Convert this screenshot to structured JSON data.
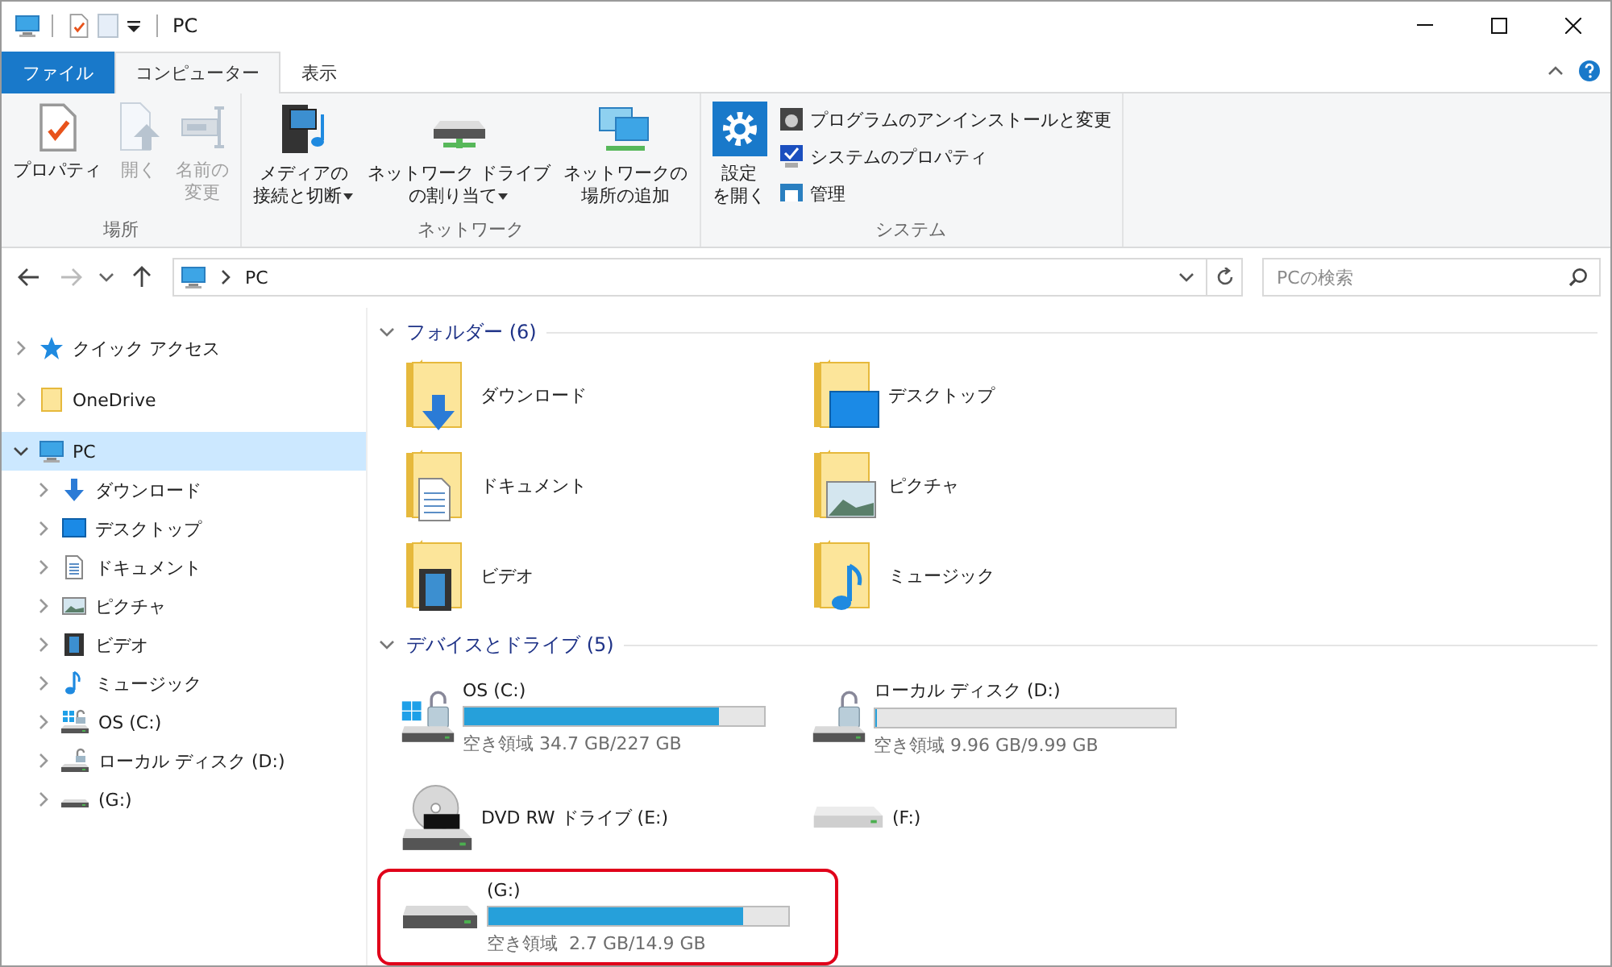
{
  "title_bar": {
    "title": "PC"
  },
  "ribbon_tabs": [
    {
      "label": "ファイル",
      "kind": "file",
      "selected": false
    },
    {
      "label": "コンピューター",
      "kind": "tab",
      "selected": true
    },
    {
      "label": "表示",
      "kind": "tab",
      "selected": false
    }
  ],
  "ribbon_groups": [
    {
      "label": "場所",
      "buttons": [
        {
          "lines": [
            "プロパティ"
          ],
          "kind": "properties",
          "disabled": false,
          "dropdown": false
        },
        {
          "lines": [
            "開く"
          ],
          "kind": "open",
          "disabled": true,
          "dropdown": false
        },
        {
          "lines": [
            "名前の",
            "変更"
          ],
          "kind": "rename",
          "disabled": true,
          "dropdown": false
        }
      ]
    },
    {
      "label": "ネットワーク",
      "buttons": [
        {
          "lines": [
            "メディアの",
            "接続と切断"
          ],
          "kind": "media",
          "disabled": false,
          "dropdown": true
        },
        {
          "lines": [
            "ネットワーク ドライブ",
            "の割り当て"
          ],
          "kind": "netdrive",
          "disabled": false,
          "dropdown": true
        },
        {
          "lines": [
            "ネットワークの",
            "場所の追加"
          ],
          "kind": "netplace",
          "disabled": false,
          "dropdown": false
        }
      ]
    },
    {
      "label": "システム",
      "buttons": [
        {
          "lines": [
            "設定",
            "を開く"
          ],
          "kind": "settings",
          "disabled": false,
          "dropdown": false
        }
      ],
      "small_buttons": [
        {
          "label": "プログラムのアンインストールと変更",
          "kind": "uninstall",
          "disabled": false
        },
        {
          "label": "システムのプロパティ",
          "kind": "sysprops",
          "disabled": false
        },
        {
          "label": "管理",
          "kind": "manage",
          "disabled": false
        }
      ]
    }
  ],
  "address_bar": {
    "path": "PC",
    "search_placeholder": "PCの検索"
  },
  "sidebar": {
    "items": [
      {
        "label": "クイック アクセス",
        "kind": "quick",
        "expanded": false,
        "selected": false
      },
      {
        "label": "OneDrive",
        "kind": "folder",
        "expanded": false,
        "selected": false
      },
      {
        "label": "PC",
        "kind": "pc",
        "expanded": true,
        "selected": true,
        "children": [
          {
            "label": "ダウンロード",
            "kind": "download",
            "expanded": false,
            "selected": false
          },
          {
            "label": "デスクトップ",
            "kind": "desktop",
            "expanded": false,
            "selected": false
          },
          {
            "label": "ドキュメント",
            "kind": "documents",
            "expanded": false,
            "selected": false
          },
          {
            "label": "ピクチャ",
            "kind": "pictures",
            "expanded": false,
            "selected": false
          },
          {
            "label": "ビデオ",
            "kind": "videos",
            "expanded": false,
            "selected": false
          },
          {
            "label": "ミュージック",
            "kind": "music",
            "expanded": false,
            "selected": false
          },
          {
            "label": "OS (C:)",
            "kind": "os_drive",
            "expanded": false,
            "selected": false
          },
          {
            "label": "ローカル ディスク (D:)",
            "kind": "locked_drive",
            "expanded": false,
            "selected": false
          },
          {
            "label": " (G:)",
            "kind": "drive",
            "expanded": false,
            "selected": false
          }
        ]
      }
    ]
  },
  "folders": {
    "title": "フォルダー (6)",
    "expanded": true,
    "items": [
      {
        "label": "ダウンロード",
        "kind": "download"
      },
      {
        "label": "デスクトップ",
        "kind": "desktop"
      },
      {
        "label": "ドキュメント",
        "kind": "documents"
      },
      {
        "label": "ピクチャ",
        "kind": "pictures"
      },
      {
        "label": "ビデオ",
        "kind": "videos"
      },
      {
        "label": "ミュージック",
        "kind": "music"
      }
    ]
  },
  "drives": {
    "title": "デバイスとドライブ (5)",
    "expanded": true,
    "items": [
      {
        "name": "OS (C:)",
        "kind": "os",
        "level": 0.85,
        "free": "空き領域 34.7 GB/227 GB",
        "highlighted": false
      },
      {
        "name": "ローカル ディスク (D:)",
        "kind": "locked",
        "level": 0.003,
        "free": "空き領域 9.96 GB/9.99 GB",
        "highlighted": false
      },
      {
        "name": "DVD RW ドライブ (E:)",
        "kind": "dvd",
        "highlighted": false
      },
      {
        "name": "(F:)",
        "kind": "removable",
        "highlighted": false
      },
      {
        "name": "(G:)",
        "kind": "drive",
        "level": 0.85,
        "free": "空き領域  2.7 GB/14.9 GB",
        "highlighted": true
      }
    ]
  }
}
